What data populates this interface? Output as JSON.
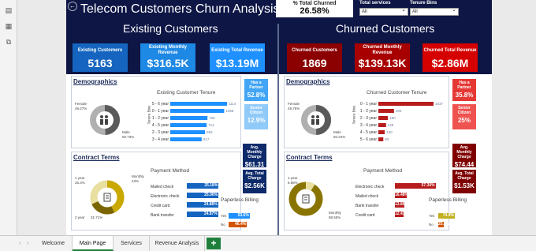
{
  "report_title": "Telecom Customers Churn Analysis",
  "top_kpi": {
    "label": "% Total Churned",
    "value": "26.58%"
  },
  "slicers": [
    {
      "label": "Total services",
      "value": "All"
    },
    {
      "label": "Tenure Bins",
      "value": "All"
    }
  ],
  "existing": {
    "section_title": "Existing Customers",
    "cards": [
      {
        "label": "Existing Customers",
        "value": "5163"
      },
      {
        "label": "Existing Monthly Revenue",
        "value": "$316.5K"
      },
      {
        "label": "Existing Total Revenue",
        "value": "$13.19M"
      }
    ],
    "demographics_title": "Demographics",
    "gender": {
      "female_label": "Female",
      "female_pct": "49.27%",
      "male_label": "Male",
      "male_pct": "50.73%"
    },
    "tenure_title": "Existing Customer Tenure",
    "tenure_axis": "Tenure Bins",
    "tenure": [
      {
        "label": "5 - 6 year",
        "value": 1114
      },
      {
        "label": "0 - 1 year",
        "value": 1058
      },
      {
        "label": "1 - 2 year",
        "value": 730
      },
      {
        "label": "4 - 5 year",
        "value": 714
      },
      {
        "label": "2 - 3 year",
        "value": 682
      },
      {
        "label": "3 - 4 year",
        "value": 617
      }
    ],
    "partner": {
      "label": "Has a Partner",
      "value": "52.8%"
    },
    "senior": {
      "label": "Senior Citizen",
      "value": "12.9%"
    },
    "contract_title": "Contract Terms",
    "contract": {
      "monthly_label": "Monthly",
      "monthly_pct": "43%",
      "one_label": "1 year",
      "one_pct": "25.3%",
      "two_label": "2 year",
      "two_pct": "31.71%"
    },
    "payment_title": "Payment Method",
    "payment": [
      {
        "label": "Mailed check",
        "value": 25.18,
        "text": "25.18%"
      },
      {
        "label": "Electronic check",
        "value": 25.06,
        "text": "25.06%"
      },
      {
        "label": "Credit card",
        "value": 24.88,
        "text": "24.88%"
      },
      {
        "label": "Bank transfer",
        "value": 24.87,
        "text": "24.87%"
      }
    ],
    "avg_monthly": {
      "label": "Avg. Monthly Charge",
      "value": "$61.31"
    },
    "avg_total": {
      "label": "Avg. Total Charge",
      "value": "$2.56K"
    },
    "paperless_title": "Paperless Billing",
    "paperless": [
      {
        "label": "Yes",
        "value": 53.6,
        "text": "53.6%"
      },
      {
        "label": "No",
        "value": 46.4,
        "text": "46.4%"
      }
    ]
  },
  "churned": {
    "section_title": "Churned Customers",
    "cards": [
      {
        "label": "Churned Customers",
        "value": "1869"
      },
      {
        "label": "Churned Monthly Revenue",
        "value": "$139.13K"
      },
      {
        "label": "Churned Total Revenue",
        "value": "$2.86M"
      }
    ],
    "demographics_title": "Demographics",
    "gender": {
      "female_label": "Female",
      "female_pct": "49.76%",
      "male_label": "Male",
      "male_pct": "50.24%"
    },
    "tenure_title": "Churned Customer Tenure",
    "tenure_axis": "Tenure Bins",
    "tenure": [
      {
        "label": "0 - 1 year",
        "value": 1037
      },
      {
        "label": "1 - 2 year",
        "value": 294
      },
      {
        "label": "2 - 3 year",
        "value": 180
      },
      {
        "label": "3 - 4 year",
        "value": 145
      },
      {
        "label": "4 - 5 year",
        "value": 120
      },
      {
        "label": "5 - 6 year",
        "value": 93
      }
    ],
    "partner": {
      "label": "Has a Partner",
      "value": "35.8%"
    },
    "senior": {
      "label": "Senior Citizen",
      "value": "25%"
    },
    "contract_title": "Contract Terms",
    "contract": {
      "monthly_label": "Monthly",
      "monthly_pct": "88.55%",
      "one_label": "1 year",
      "one_pct": "8.88%"
    },
    "payment_title": "Payment Method",
    "payment": [
      {
        "label": "Electronic check",
        "value": 57.3,
        "text": "57.30%"
      },
      {
        "label": "Mailed check",
        "value": 16.48,
        "text": "16.48%"
      },
      {
        "label": "Bank transfer",
        "value": 13.8,
        "text": "13.80%"
      },
      {
        "label": "Credit card",
        "value": 12.41,
        "text": "12.41%"
      }
    ],
    "avg_monthly": {
      "label": "Avg. Monthly Charge",
      "value": "$74.44"
    },
    "avg_total": {
      "label": "Avg. Total Charge",
      "value": "$1.53K"
    },
    "paperless_title": "Paperless Billing",
    "paperless": [
      {
        "label": "Yes",
        "value": 74.9,
        "text": "74.9%"
      },
      {
        "label": "No",
        "value": 25.1,
        "text": "25.1%"
      }
    ]
  },
  "tabs": [
    "Welcome",
    "Main Page",
    "Services",
    "Revenue Analysis"
  ],
  "active_tab": "Main Page",
  "add_tab": "+",
  "colors": {
    "navy": "#0d1645",
    "existing_blue": "#1e90ff",
    "card_blue": "#1565c0",
    "churn_red": "#b71c1c",
    "churn_dark": "#7f0000",
    "gold": "#c9a800",
    "excel_green": "#1e7f3c"
  },
  "icons": [
    "report-view-icon",
    "table-view-icon",
    "model-view-icon",
    "back-icon",
    "family-icon",
    "contract-doc-icon"
  ]
}
